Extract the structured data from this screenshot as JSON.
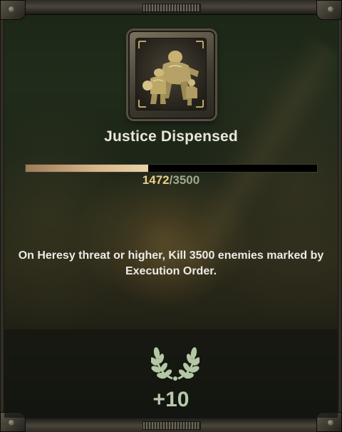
{
  "achievement": {
    "title": "Justice Dispensed",
    "icon": "ogryn-squad-emblem-icon",
    "progress": {
      "current": "1472",
      "separator": "/",
      "total": "3500",
      "fraction": 0.4206
    },
    "description": "On Heresy threat or higher, Kill 3500 enemies marked by Execution Order.",
    "reward": {
      "icon": "laurel-wreath-icon",
      "value": "+10"
    }
  },
  "colors": {
    "title": "#e8e6df",
    "progress_current": "#e6cf8a",
    "progress_total": "#9ca98c",
    "progress_fill": "#d5b48a",
    "reward": "#b8c8ab"
  }
}
